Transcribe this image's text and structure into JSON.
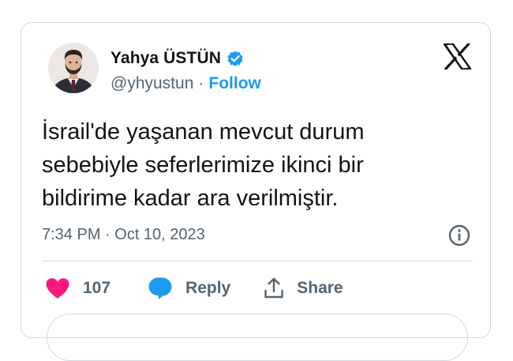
{
  "author": {
    "display_name": "Yahya ÜSTÜN",
    "handle": "@yhyustun",
    "separator": "·",
    "follow_label": "Follow"
  },
  "tweet": {
    "lines": [
      "İsrail'de yaşanan mevcut durum",
      "sebebiyle seferlerimize ikinci bir",
      "bildirime kadar ara verilmiştir."
    ],
    "timestamp": "7:34 PM · Oct 10, 2023"
  },
  "actions": {
    "like_count": "107",
    "reply_label": "Reply",
    "share_label": "Share"
  },
  "colors": {
    "accent": "#1d9bf0",
    "like": "#f91880",
    "text": "#0f1419",
    "muted": "#536471",
    "border": "#cfd9de"
  },
  "icons": [
    "verified-badge-icon",
    "x-logo-icon",
    "info-icon",
    "heart-icon",
    "reply-bubble-icon",
    "share-icon"
  ]
}
